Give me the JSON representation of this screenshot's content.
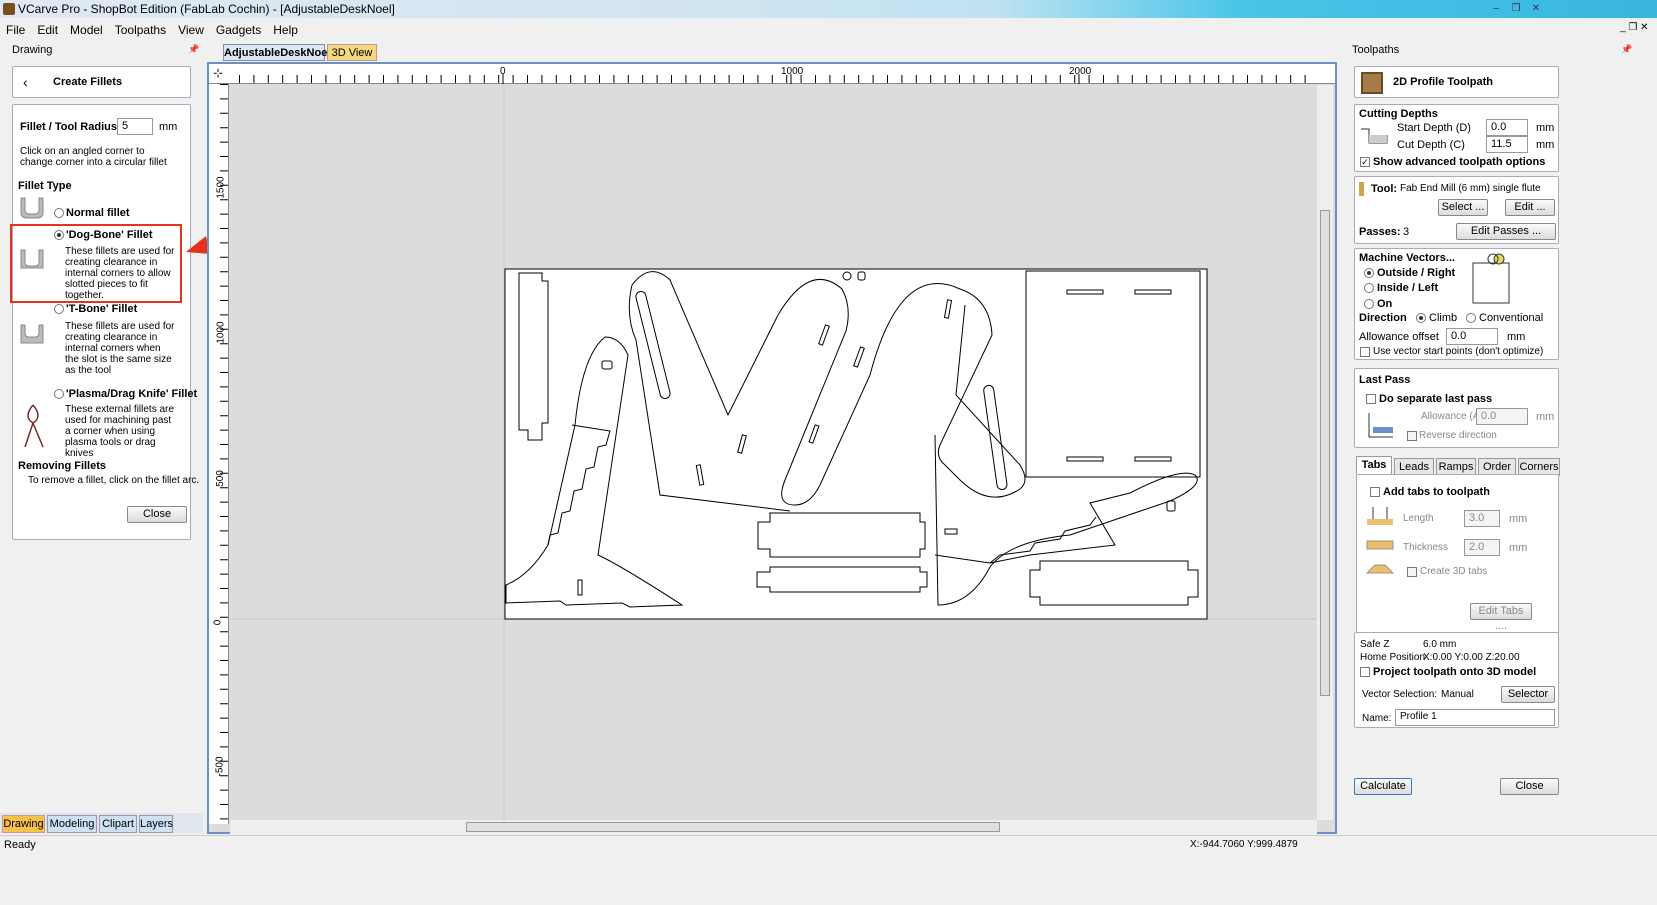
{
  "window": {
    "title": "VCarve Pro - ShopBot Edition (FabLab Cochin) - [AdjustableDeskNoel]",
    "min": "–",
    "max": "❐",
    "close": "✕"
  },
  "menu": [
    "File",
    "Edit",
    "Model",
    "Toolpaths",
    "View",
    "Gadgets",
    "Help"
  ],
  "left": {
    "header": "Drawing",
    "form_title": "Create Fillets",
    "radius_label": "Fillet / Tool Radius:",
    "radius_value": "5",
    "radius_unit": "mm",
    "hint": "Click on an angled corner to change corner into a circular fillet",
    "fillet_type": "Fillet Type",
    "normal": "Normal fillet",
    "dogbone": "'Dog-Bone' Fillet",
    "dogbone_desc": "These fillets are used for creating clearance in internal corners to allow slotted pieces to fit together.",
    "tbone": "'T-Bone' Fillet",
    "tbone_desc": "These fillets are used for creating clearance in internal corners when the slot is the same size as the tool",
    "plasma": "'Plasma/Drag Knife' Fillet",
    "plasma_desc": "These external fillets are used for machining past a corner when using plasma tools or drag knives",
    "removing": "Removing Fillets",
    "removing_desc": "To remove a fillet, click on the fillet arc.",
    "close": "Close",
    "tabs": [
      "Drawing",
      "Modeling",
      "Clipart",
      "Layers"
    ],
    "highlight_color": "#e8321f"
  },
  "doc_tabs": [
    "AdjustableDeskNoel",
    "3D View"
  ],
  "ruler": {
    "h": [
      "0",
      "1000",
      "2000"
    ],
    "v": [
      "1500",
      "1000",
      "500",
      "0",
      "-500"
    ]
  },
  "right": {
    "header": "Toolpaths",
    "title": "2D Profile Toolpath",
    "cutting_depths": "Cutting Depths",
    "start_depth_label": "Start Depth (D)",
    "start_depth": "0.0",
    "cut_depth_label": "Cut Depth (C)",
    "cut_depth": "11.5",
    "mm": "mm",
    "show_adv": "Show advanced toolpath options",
    "tool_label": "Tool:",
    "tool_value": "Fab End Mill (6 mm) single flute",
    "select": "Select ...",
    "edit": "Edit ...",
    "passes_label": "Passes:",
    "passes": "3",
    "edit_passes": "Edit Passes ...",
    "machine_vectors": "Machine Vectors...",
    "outside": "Outside / Right",
    "inside": "Inside / Left",
    "on": "On",
    "direction": "Direction",
    "climb": "Climb",
    "conventional": "Conventional",
    "allowance_label": "Allowance offset",
    "allowance": "0.0",
    "vector_start": "Use vector start points (don't optimize)",
    "last_pass": "Last Pass",
    "separate": "Do separate last pass",
    "allowance_a": "Allowance (A)",
    "allowance_a_val": "0.0",
    "reverse": "Reverse direction",
    "tabs": [
      "Tabs",
      "Leads",
      "Ramps",
      "Order",
      "Corners"
    ],
    "add_tabs": "Add tabs to toolpath",
    "length_label": "Length",
    "length": "3.0",
    "thickness_label": "Thickness",
    "thickness": "2.0",
    "create3d": "Create 3D tabs",
    "edit_tabs": "Edit Tabs ....",
    "safez_label": "Safe Z",
    "safez": "6.0 mm",
    "home_label": "Home Position",
    "home": "X:0.00 Y:0.00 Z:20.00",
    "project": "Project toolpath onto 3D model",
    "vsel_label": "Vector Selection:",
    "vsel": "Manual",
    "selector": "Selector ...",
    "name_label": "Name:",
    "name": "Profile 1",
    "calculate": "Calculate",
    "close": "Close"
  },
  "status": {
    "left": "Ready",
    "coords": "X:-944.7060 Y:999.4879"
  }
}
